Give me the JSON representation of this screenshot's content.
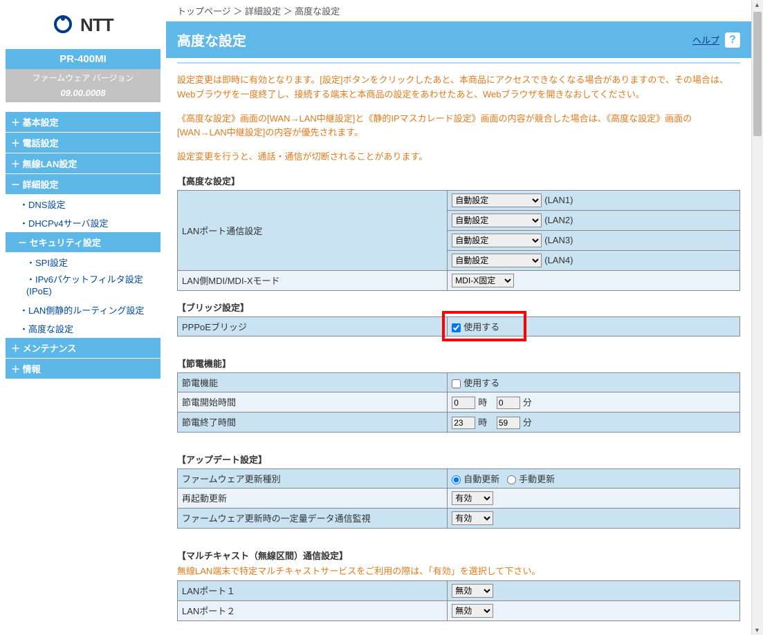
{
  "logo_text": "NTT",
  "model": "PR-400MI",
  "fw_label": "ファームウェア バージョン",
  "fw_version": "09.00.0008",
  "nav": {
    "headers": [
      "＋ 基本設定",
      "＋ 電話設定",
      "＋ 無線LAN設定",
      "－ 詳細設定",
      "＋ メンテナンス",
      "＋ 情報"
    ],
    "detail_subs": [
      "DNS設定",
      "DHCPv4サーバ設定"
    ],
    "sec_head": "－ セキュリティ設定",
    "sec_subs": [
      "SPI設定",
      "IPv6パケットフィルタ設定(IPoE)"
    ],
    "detail_subs2": [
      "LAN側静的ルーティング設定",
      "高度な設定"
    ]
  },
  "breadcrumb": "トップページ ＞ 詳細設定 ＞ 高度な設定",
  "page_title": "高度な設定",
  "help": "ヘルプ",
  "warnings": [
    "設定変更は即時に有効となります。[設定]ボタンをクリックしたあと、本商品にアクセスできなくなる場合がありますので、その場合は、Webブラウザを一度終了し、接続する端末と本商品の設定をあわせたあと、Webブラウザを開きなおしてください。",
    "《高度な設定》画面の[WAN→LAN中継設定]と《静的IPマスカレード設定》画面の内容が競合した場合は、《高度な設定》画面の[WAN→LAN中継設定]の内容が優先されます。",
    "設定変更を行うと、通話・通信が切断されることがあります。"
  ],
  "sections": {
    "advanced": {
      "title": "【高度な設定】",
      "lan_port_label": "LANポート通信設定",
      "lan_ports": [
        {
          "value": "自動設定",
          "suffix": "(LAN1)"
        },
        {
          "value": "自動設定",
          "suffix": "(LAN2)"
        },
        {
          "value": "自動設定",
          "suffix": "(LAN3)"
        },
        {
          "value": "自動設定",
          "suffix": "(LAN4)"
        }
      ],
      "mdi_label": "LAN側MDI/MDI-Xモード",
      "mdi_value": "MDI-X固定"
    },
    "bridge": {
      "title": "【ブリッジ設定】",
      "row_label": "PPPoEブリッジ",
      "use_label": "使用する"
    },
    "power": {
      "title": "【節電機能】",
      "row1": "節電機能",
      "use_label": "使用する",
      "row2": "節電開始時間",
      "row3": "節電終了時間",
      "start_h": "0",
      "start_m": "0",
      "end_h": "23",
      "end_m": "59",
      "unit_h": "時",
      "unit_m": "分"
    },
    "update": {
      "title": "【アップデート設定】",
      "row1": "ファームウェア更新種別",
      "auto": "自動更新",
      "manual": "手動更新",
      "row2": "再起動更新",
      "row2_val": "有効",
      "row3": "ファームウェア更新時の一定量データ通信監視",
      "row3_val": "有効"
    },
    "multicast": {
      "title": "【マルチキャスト（無線区間）通信設定】",
      "note": "無線LAN端末で特定マルチキャストサービスをご利用の際は、「有効」を選択して下さい。",
      "row1": "LANポート１",
      "row1_val": "無効",
      "row2": "LANポート２",
      "row2_val": "無効"
    }
  }
}
